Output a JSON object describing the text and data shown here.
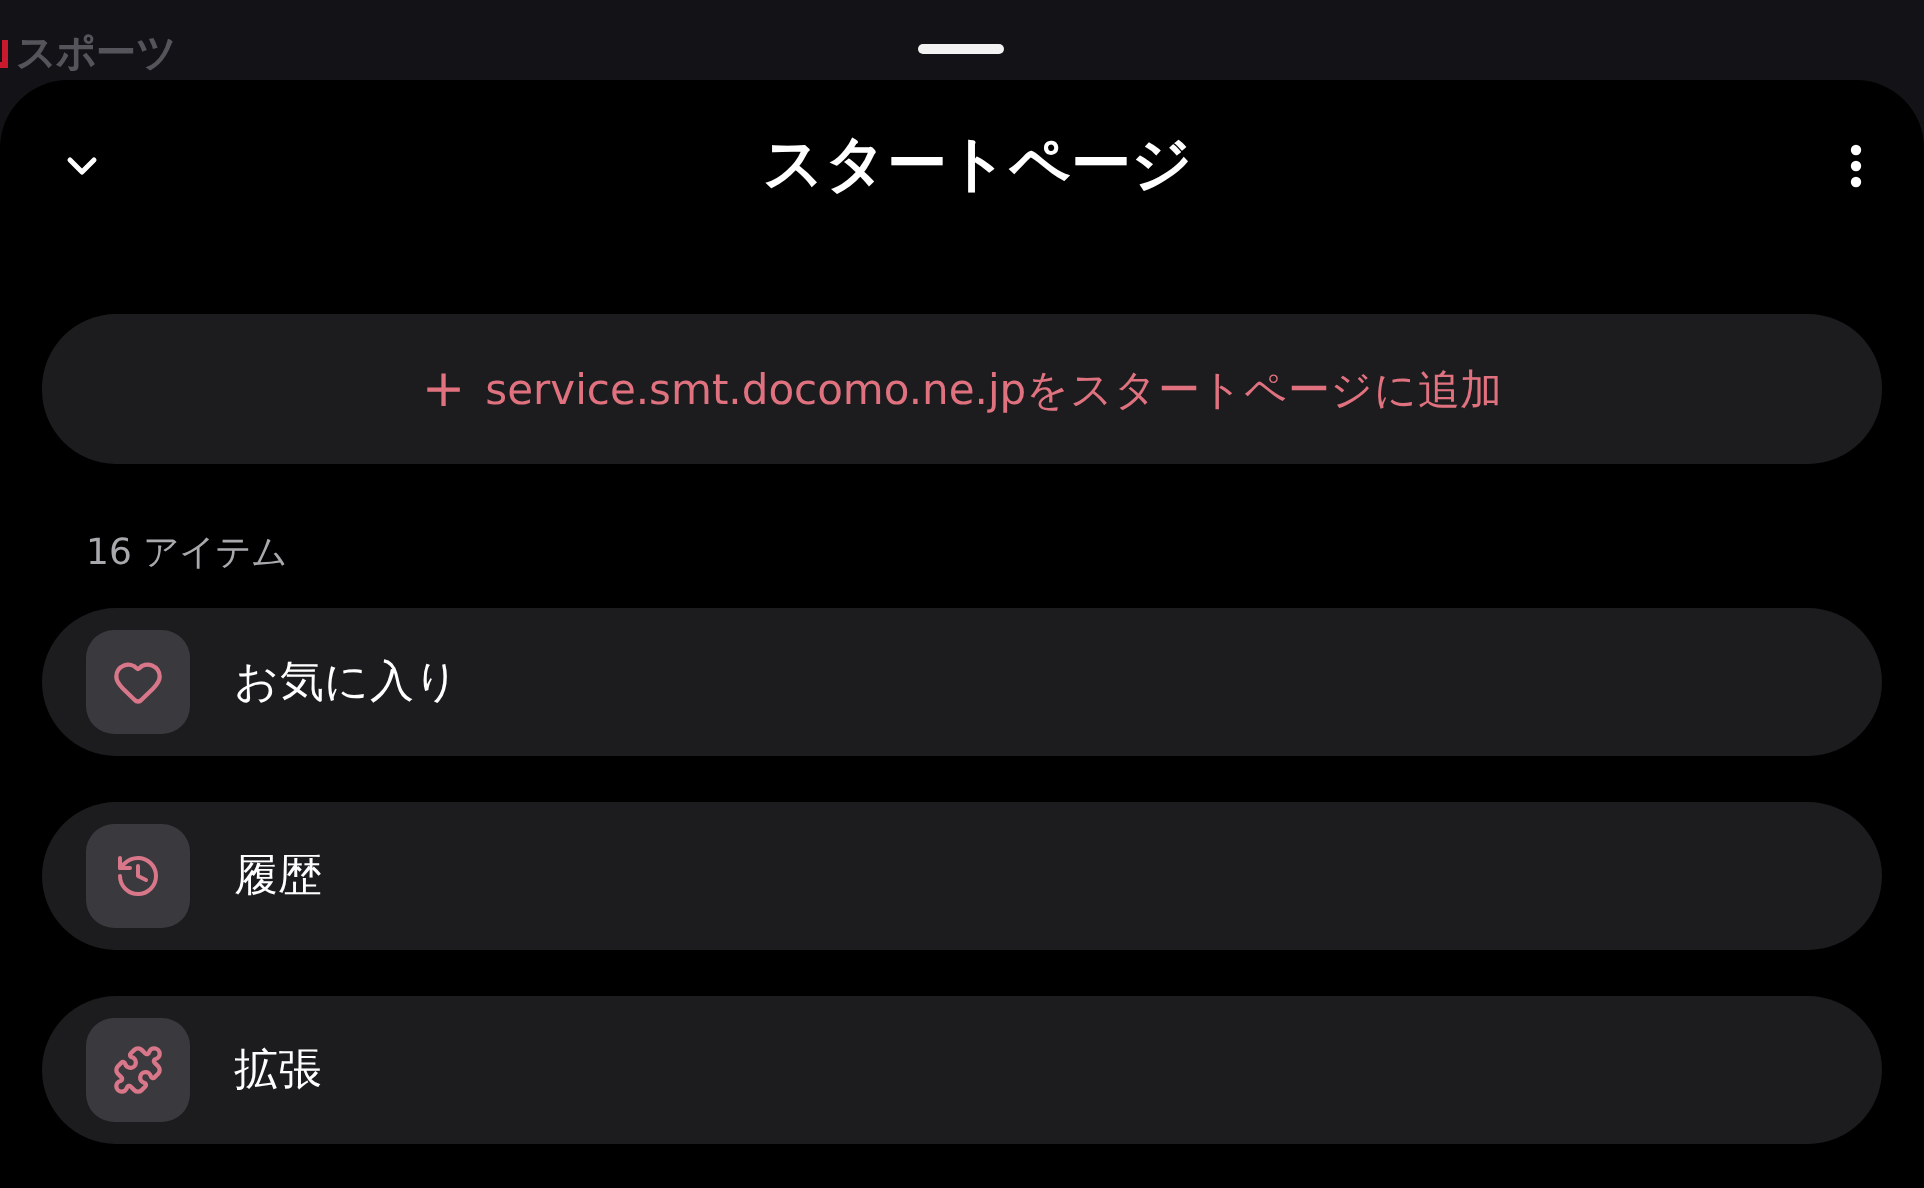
{
  "background": {
    "category": "スポーツ"
  },
  "sheet": {
    "title": "スタートページ",
    "add_button": {
      "icon": "+",
      "label": "service.smt.docomo.ne.jpをスタートページに追加"
    },
    "count": "16 アイテム",
    "items": [
      {
        "kind": "heart",
        "label": "お気に入り"
      },
      {
        "kind": "history",
        "label": "履歴"
      },
      {
        "kind": "puzzle",
        "label": "拡張"
      }
    ]
  }
}
